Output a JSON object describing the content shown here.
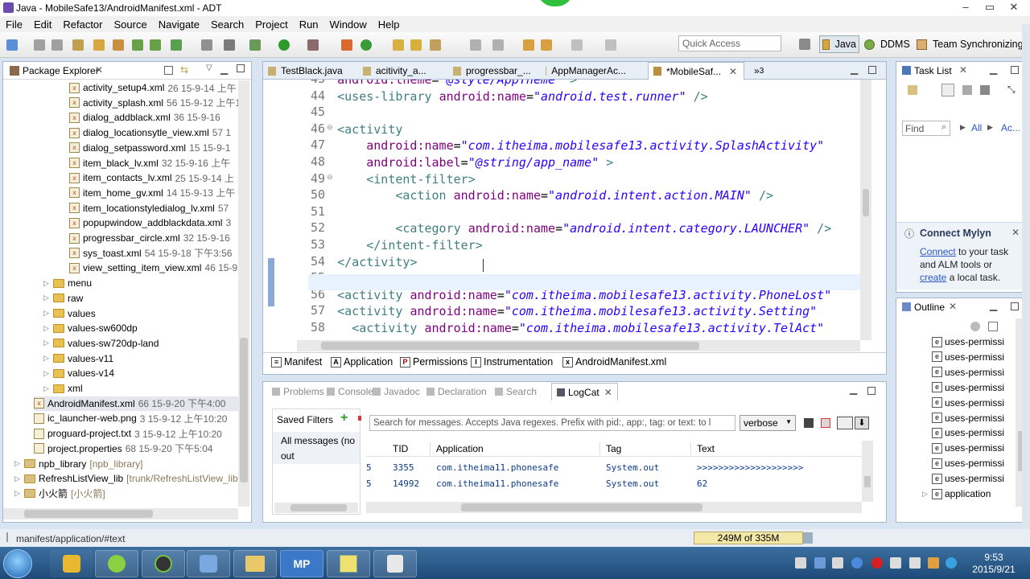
{
  "window": {
    "title": "Java - MobileSafe13/AndroidManifest.xml - ADT"
  },
  "menu": [
    "File",
    "Edit",
    "Refactor",
    "Source",
    "Navigate",
    "Search",
    "Project",
    "Run",
    "Window",
    "Help"
  ],
  "quick_access": {
    "placeholder": "Quick Access"
  },
  "perspectives": [
    "Java",
    "DDMS",
    "Team Synchronizing"
  ],
  "package_explorer": {
    "title": "Package Explorer",
    "files": [
      {
        "name": "activity_setup4.xml",
        "meta": "26  15-9-14 上午"
      },
      {
        "name": "activity_splash.xml",
        "meta": "56  15-9-12 上午1"
      },
      {
        "name": "dialog_addblack.xml",
        "meta": "36  15-9-16 "
      },
      {
        "name": "dialog_locationsytle_view.xml",
        "meta": "57  1"
      },
      {
        "name": "dialog_setpassword.xml",
        "meta": "15  15-9-1"
      },
      {
        "name": "item_black_lv.xml",
        "meta": "32  15-9-16 上午"
      },
      {
        "name": "item_contacts_lv.xml",
        "meta": "25  15-9-14 上"
      },
      {
        "name": "item_home_gv.xml",
        "meta": "14  15-9-13 上午"
      },
      {
        "name": "item_locationstyledialog_lv.xml",
        "meta": "57"
      },
      {
        "name": "popupwindow_addblackdata.xml",
        "meta": "3"
      },
      {
        "name": "progressbar_circle.xml",
        "meta": "32  15-9-16"
      },
      {
        "name": "sys_toast.xml",
        "meta": "54  15-9-18 下午3:56"
      },
      {
        "name": "view_setting_item_view.xml",
        "meta": "46  15-9"
      }
    ],
    "folders": [
      "menu",
      "raw",
      "values",
      "values-sw600dp",
      "values-sw720dp-land",
      "values-v11",
      "values-v14",
      "xml"
    ],
    "root_files": [
      {
        "name": "AndroidManifest.xml",
        "meta": "66  15-9-20 下午4:00"
      },
      {
        "name": "ic_launcher-web.png",
        "meta": "3  15-9-12 上午10:20"
      },
      {
        "name": "proguard-project.txt",
        "meta": "3  15-9-12 上午10:20"
      },
      {
        "name": "project.properties",
        "meta": "68  15-9-20 下午5:04"
      }
    ],
    "projects": [
      {
        "name": "npb_library",
        "meta": "[npb_library]"
      },
      {
        "name": "RefreshListView_lib",
        "meta": "[trunk/RefreshListView_lib"
      },
      {
        "name": "小火箭",
        "meta": "[小火箭]"
      }
    ]
  },
  "editor_tabs": [
    "TestBlack.java",
    "acitivity_a...",
    "progressbar_...",
    "AppManagerAc...",
    "*MobileSaf..."
  ],
  "editor_tabs_more": "3",
  "code_lines": [
    {
      "n": "43",
      "text": "    android:theme=\"@style/AppTheme\" >"
    },
    {
      "n": "44",
      "text": "    <uses-library android:name=\"android.test.runner\" />"
    },
    {
      "n": "45",
      "text": ""
    },
    {
      "n": "46",
      "text": "    <activity"
    },
    {
      "n": "47",
      "text": "        android:name=\"com.itheima.mobilesafe13.activity.SplashActivity\""
    },
    {
      "n": "48",
      "text": "        android:label=\"@string/app_name\" >"
    },
    {
      "n": "49",
      "text": "        <intent-filter>"
    },
    {
      "n": "50",
      "text": "            <action android:name=\"android.intent.action.MAIN\" />"
    },
    {
      "n": "51",
      "text": ""
    },
    {
      "n": "52",
      "text": "            <category android:name=\"android.intent.category.LAUNCHER\" />"
    },
    {
      "n": "53",
      "text": "        </intent-filter>"
    },
    {
      "n": "54",
      "text": "    </activity>"
    },
    {
      "n": "55",
      "text": "    <"
    },
    {
      "n": "56",
      "text": "    <activity android:name=\"com.itheima.mobilesafe13.activity.PhoneLost\""
    },
    {
      "n": "57",
      "text": "    <activity android:name=\"com.itheima.mobilesafe13.activity.Setting\""
    },
    {
      "n": "58",
      "text": "      <activity android:name=\"com.itheima.mobilesafe13.activity.TelAct\""
    }
  ],
  "manifest_tabs": [
    "Manifest",
    "Application",
    "Permissions",
    "Instrumentation",
    "AndroidManifest.xml"
  ],
  "console_tabs": [
    "Problems",
    "Console",
    "Javadoc",
    "Declaration",
    "Search",
    "LogCat"
  ],
  "logcat": {
    "saved_filters": "Saved Filters",
    "filter_item": "All messages (no",
    "filter_item2": "out",
    "search_placeholder": "Search for messages. Accepts Java regexes. Prefix with pid:, app:, tag: or text: to l",
    "level": "verbose",
    "columns": [
      "TID",
      "Application",
      "Tag",
      "Text"
    ],
    "rows": [
      {
        "tid": "3355",
        "app": "com.itheima11.phonesafe",
        "tag": "System.out",
        "text": ">>>>>>>>>>>>>>>>>>>>"
      },
      {
        "tid": "14992",
        "app": "com.itheima11.phonesafe",
        "tag": "System.out",
        "text": "62"
      }
    ]
  },
  "task_list": {
    "title": "Task List",
    "find": "Find",
    "all": "All",
    "ac": "Ac..."
  },
  "mylyn": {
    "title": "Connect Mylyn",
    "l1a": "Connect",
    "l1b": " to your task",
    "l2": "and ALM tools or",
    "l3a": "create",
    "l3b": " a local task."
  },
  "outline": {
    "title": "Outline",
    "items": [
      "uses-permissi",
      "uses-permissi",
      "uses-permissi",
      "uses-permissi",
      "uses-permissi",
      "uses-permissi",
      "uses-permissi",
      "uses-permissi",
      "uses-permissi",
      "uses-permissi"
    ],
    "last": "application"
  },
  "status": {
    "path": "manifest/application/#text",
    "memory": "249M of 335M"
  },
  "clock": {
    "time": "9:53",
    "date": "2015/9/21"
  },
  "taskbar_apps": [
    "MP"
  ],
  "colors": {
    "accent": "#3399ff",
    "taskbar": "#2b5a8a"
  }
}
